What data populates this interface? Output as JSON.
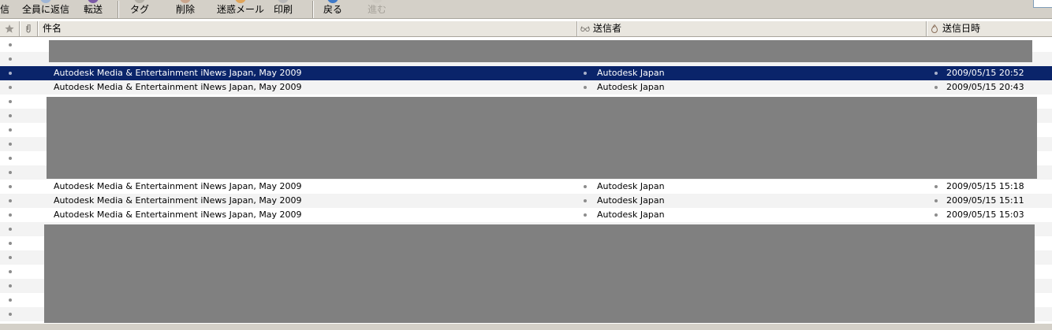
{
  "toolbar": {
    "reply_fragment": "信",
    "reply_all": "全員に返信",
    "forward": "転送",
    "tag": "タグ",
    "delete": "削除",
    "junk": "迷惑メール",
    "print": "印刷",
    "back": "戻る",
    "forward_nav": "進む"
  },
  "columns": {
    "subject": "件名",
    "sender": "送信者",
    "date": "送信日時"
  },
  "messages": [
    {
      "subject": "Autodesk Media & Entertainment iNews Japan, May 2009",
      "sender": "Autodesk Japan",
      "date": "2009/05/15 20:52"
    },
    {
      "subject": "Autodesk Media & Entertainment iNews Japan, May 2009",
      "sender": "Autodesk Japan",
      "date": "2009/05/15 20:43"
    },
    {
      "subject": "Autodesk Media & Entertainment iNews Japan, May 2009",
      "sender": "Autodesk Japan",
      "date": "2009/05/15 15:18"
    },
    {
      "subject": "Autodesk Media & Entertainment iNews Japan, May 2009",
      "sender": "Autodesk Japan",
      "date": "2009/05/15 15:11"
    },
    {
      "subject": "Autodesk Media & Entertainment iNews Japan, May 2009",
      "sender": "Autodesk Japan",
      "date": "2009/05/15 15:03"
    }
  ],
  "icons": {
    "star": "star-icon",
    "attachment": "paperclip-icon",
    "thread": "glasses-icon",
    "junk_status": "flame-icon"
  },
  "colors": {
    "selection": "#0a246a",
    "redaction": "#808080"
  }
}
